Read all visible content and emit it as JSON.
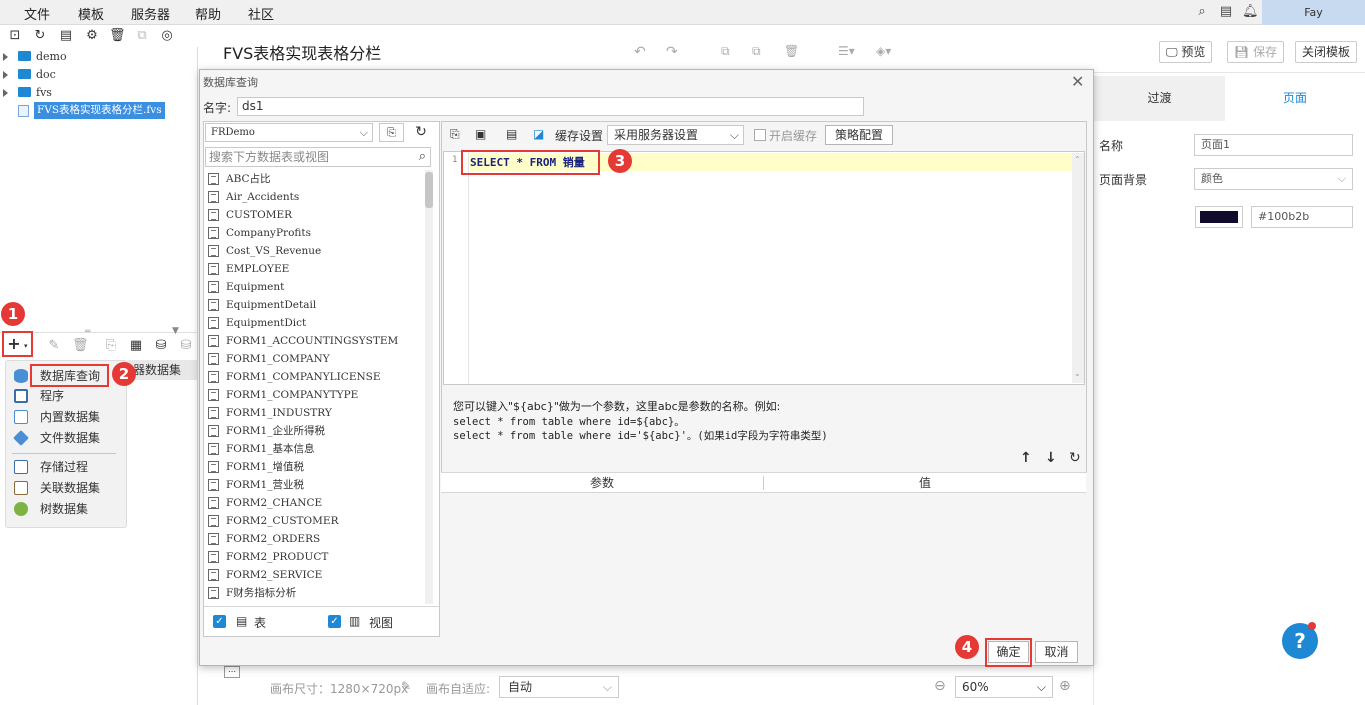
{
  "menubar": {
    "items": [
      "文件",
      "模板",
      "服务器",
      "帮助",
      "社区"
    ],
    "user": "Fay"
  },
  "tree": {
    "items": [
      "demo",
      "doc",
      "fvs"
    ],
    "selected": "FVS表格实现表格分栏.fvs"
  },
  "dataset_menu": {
    "items": [
      "数据库查询",
      "程序",
      "内置数据集",
      "文件数据集",
      "存储过程",
      "关联数据集",
      "树数据集"
    ],
    "behind_label": "器数据集"
  },
  "header": {
    "title": "FVS表格实现表格分栏",
    "preview": "预览",
    "save": "保存",
    "close_template": "关闭模板"
  },
  "right_panel": {
    "tab_transition": "过渡",
    "tab_page": "页面",
    "name_label": "名称",
    "name_value": "页面1",
    "bg_label": "页面背景",
    "bg_value": "颜色",
    "color_hex": "#100b2b"
  },
  "status_bar": {
    "canvas_size": "画布尺寸：1280×720px",
    "adaptive_label": "画布自适应:",
    "adaptive_value": "自动",
    "zoom": "60%"
  },
  "dialog": {
    "title": "数据库查询",
    "name_label": "名字:",
    "name_value": "ds1",
    "connection": "FRDemo",
    "search_placeholder": "搜索下方数据表或视图",
    "tables": [
      "ABC占比",
      "Air_Accidents",
      "CUSTOMER",
      "CompanyProfits",
      "Cost_VS_Revenue",
      "EMPLOYEE",
      "Equipment",
      "EquipmentDetail",
      "EquipmentDict",
      "FORM1_ACCOUNTINGSYSTEM",
      "FORM1_COMPANY",
      "FORM1_COMPANYLICENSE",
      "FORM1_COMPANYTYPE",
      "FORM1_INDUSTRY",
      "FORM1_企业所得税",
      "FORM1_基本信息",
      "FORM1_增值税",
      "FORM1_营业税",
      "FORM2_CHANCE",
      "FORM2_CUSTOMER",
      "FORM2_ORDERS",
      "FORM2_PRODUCT",
      "FORM2_SERVICE",
      "F财务指标分析"
    ],
    "check_table": "表",
    "check_view": "视图",
    "cache_label": "缓存设置",
    "cache_value": "采用服务器设置",
    "enable_cache": "开启缓存",
    "strategy": "策略配置",
    "line_number": "1",
    "sql": "SELECT * FROM 销量",
    "hint1": "您可以键入\"${abc}\"做为一个参数，这里abc是参数的名称。例如:",
    "hint2": "select * from table where id=${abc}。",
    "hint3": "select * from table where id='${abc}'。(如果id字段为字符串类型)",
    "param_col": "参数",
    "value_col": "值",
    "ok": "确定",
    "cancel": "取消"
  },
  "steps": [
    "1",
    "2",
    "3",
    "4"
  ],
  "colors": {
    "accent": "#1e88d4",
    "annotation": "#e53935",
    "swatch": "#100b2b"
  }
}
